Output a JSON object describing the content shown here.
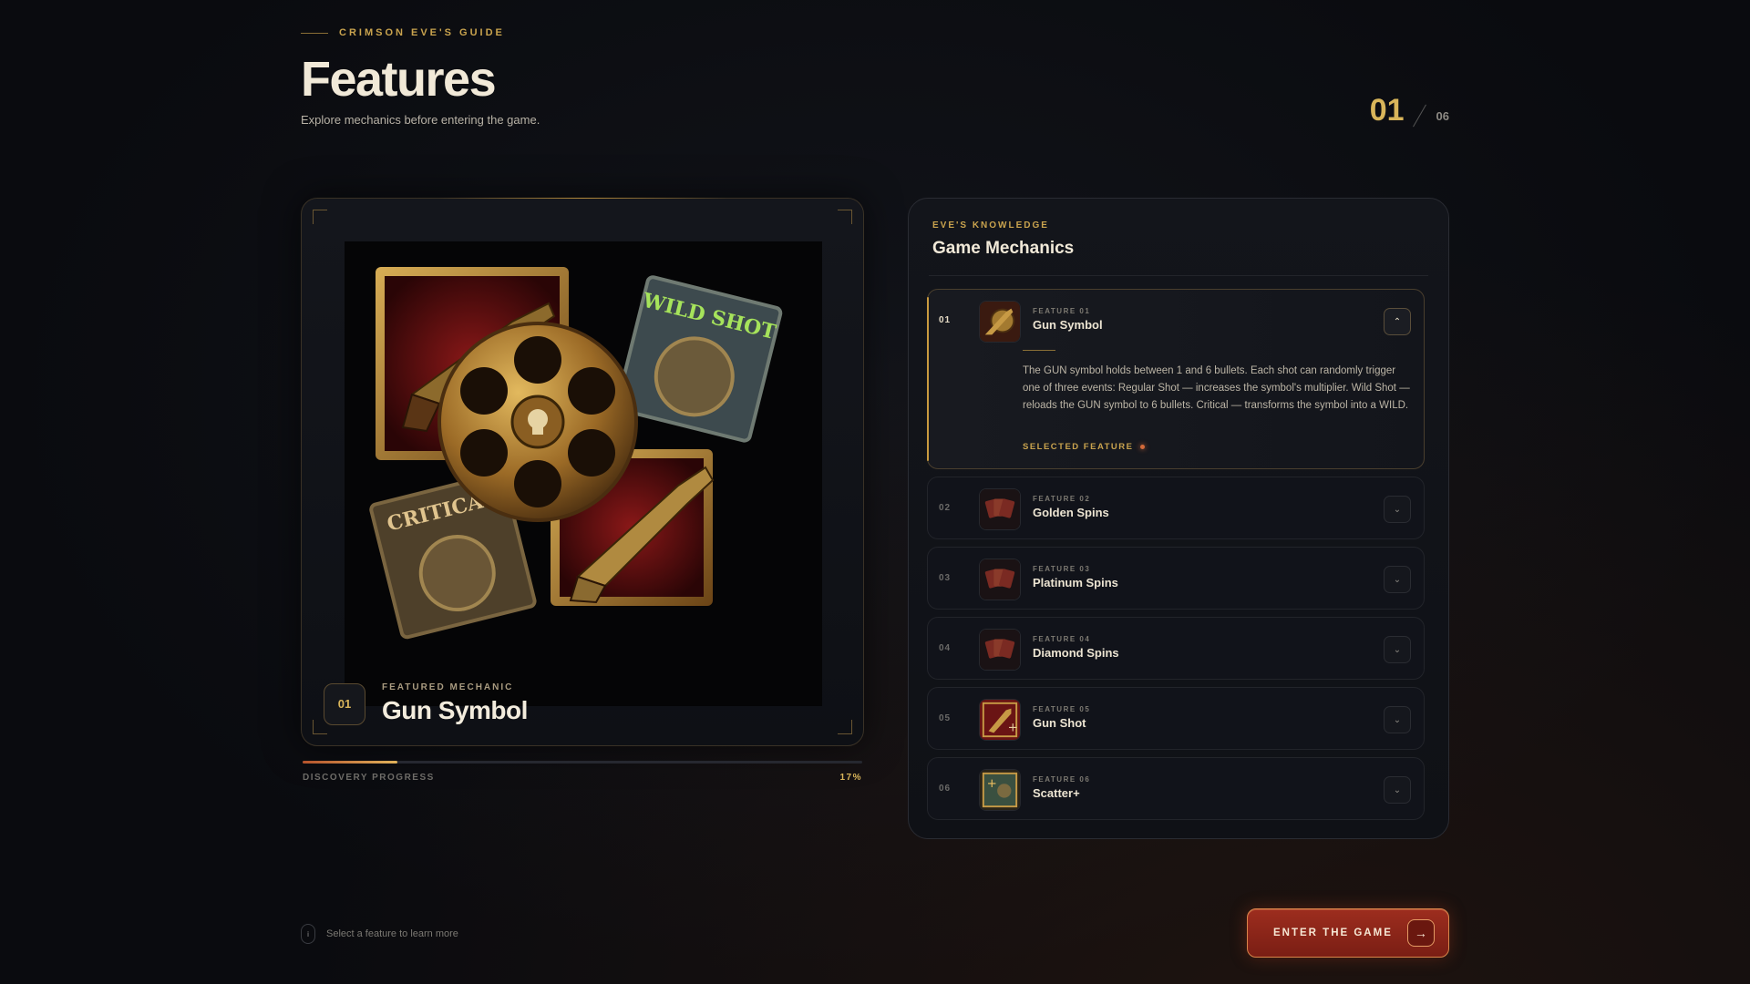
{
  "header": {
    "eyebrow": "CRIMSON EVE'S GUIDE",
    "title": "Features",
    "subtitle": "Explore mechanics before entering the game.",
    "counter_current": "01",
    "counter_total": "06"
  },
  "showcase": {
    "kicker": "FEATURED MECHANIC",
    "number": "01",
    "title": "Gun Symbol",
    "art_labels": {
      "wild": "WILD SHOT",
      "critical": "CRITICAL"
    }
  },
  "progress": {
    "label": "DISCOVERY PROGRESS",
    "percent_text": "17%",
    "value": 0.17
  },
  "panel": {
    "kicker": "EVE'S KNOWLEDGE",
    "title": "Game Mechanics",
    "items": [
      {
        "num": "01",
        "kicker": "FEATURE 01",
        "name": "Gun Symbol",
        "icon": "gun-symbol-icon",
        "expanded": true,
        "description": "The GUN symbol holds between 1 and 6 bullets. Each shot can randomly trigger one of three events: Regular Shot — increases the symbol's multiplier. Wild Shot — reloads the GUN symbol to 6 bullets. Critical — transforms the symbol into a WILD.",
        "selected_label": "SELECTED FEATURE"
      },
      {
        "num": "02",
        "kicker": "FEATURE 02",
        "name": "Golden Spins",
        "icon": "cards-icon"
      },
      {
        "num": "03",
        "kicker": "FEATURE 03",
        "name": "Platinum Spins",
        "icon": "cards-icon"
      },
      {
        "num": "04",
        "kicker": "FEATURE 04",
        "name": "Diamond Spins",
        "icon": "cards-icon"
      },
      {
        "num": "05",
        "kicker": "FEATURE 05",
        "name": "Gun Shot",
        "icon": "gun-shot-icon"
      },
      {
        "num": "06",
        "kicker": "FEATURE 06",
        "name": "Scatter+",
        "icon": "scatter-icon"
      }
    ]
  },
  "footer": {
    "hint": "Select a feature to learn more",
    "enter_label": "ENTER THE GAME"
  },
  "colors": {
    "accent_gold": "#d9b55a",
    "accent_red": "#9d2d1e"
  }
}
